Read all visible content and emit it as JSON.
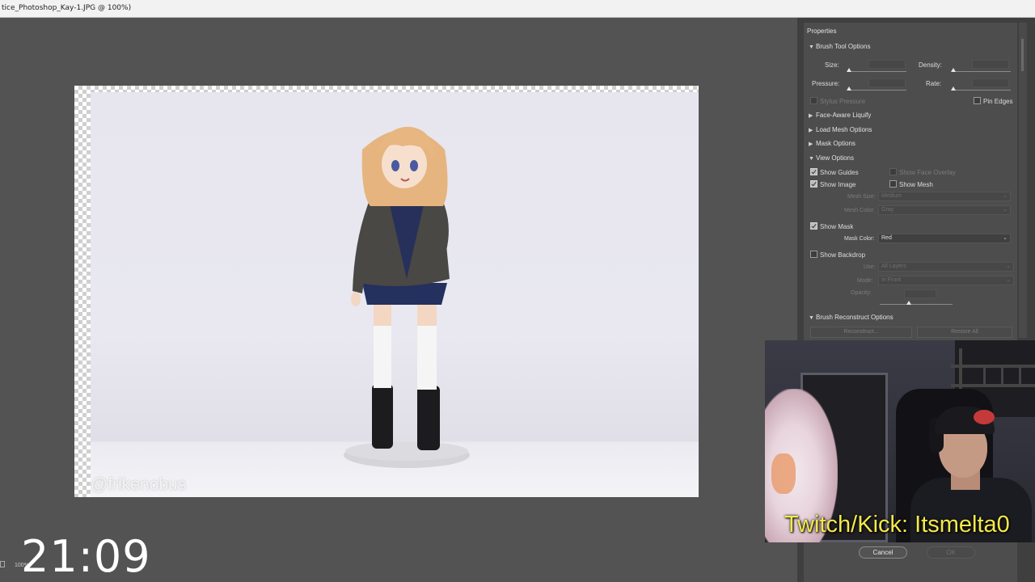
{
  "window": {
    "title": "tice_Photoshop_Kay-1.JPG @ 100%)"
  },
  "canvas": {
    "watermark": "@frikenobus",
    "zoom": "100%"
  },
  "overlay": {
    "clock": "21:09",
    "stream_text": "Twitch/Kick: Itsmelta0"
  },
  "panel": {
    "title": "Properties",
    "brush_tool_options": {
      "label": "Brush Tool Options",
      "size_label": "Size:",
      "density_label": "Density:",
      "pressure_label": "Pressure:",
      "rate_label": "Rate:",
      "stylus_pressure_label": "Stylus Pressure",
      "pin_edges_label": "Pin Edges"
    },
    "collapsed_sections": {
      "face_aware": "Face-Aware Liquify",
      "load_mesh": "Load Mesh Options",
      "mask_options": "Mask Options"
    },
    "view_options": {
      "label": "View Options",
      "show_guides": "Show Guides",
      "show_face_overlay": "Show Face Overlay",
      "show_image": "Show Image",
      "show_mesh": "Show Mesh",
      "mesh_size_label": "Mesh Size:",
      "mesh_size_value": "Medium",
      "mesh_color_label": "Mesh Color:",
      "mesh_color_value": "Gray",
      "show_mask": "Show Mask",
      "mask_color_label": "Mask Color:",
      "mask_color_value": "Red",
      "show_backdrop": "Show Backdrop",
      "use_label": "Use:",
      "use_value": "All Layers",
      "mode_label": "Mode:",
      "mode_value": "In Front",
      "opacity_label": "Opacity:"
    },
    "brush_reconstruct": {
      "label": "Brush Reconstruct Options",
      "reconstruct_button": "Reconstruct...",
      "restore_all_button": "Restore All"
    },
    "dialog": {
      "cancel": "Cancel",
      "ok": "OK"
    }
  },
  "colors": {
    "panel_bg": "#4d4d4d",
    "workspace_bg": "#535353",
    "stream_text": "#f4e94a"
  }
}
